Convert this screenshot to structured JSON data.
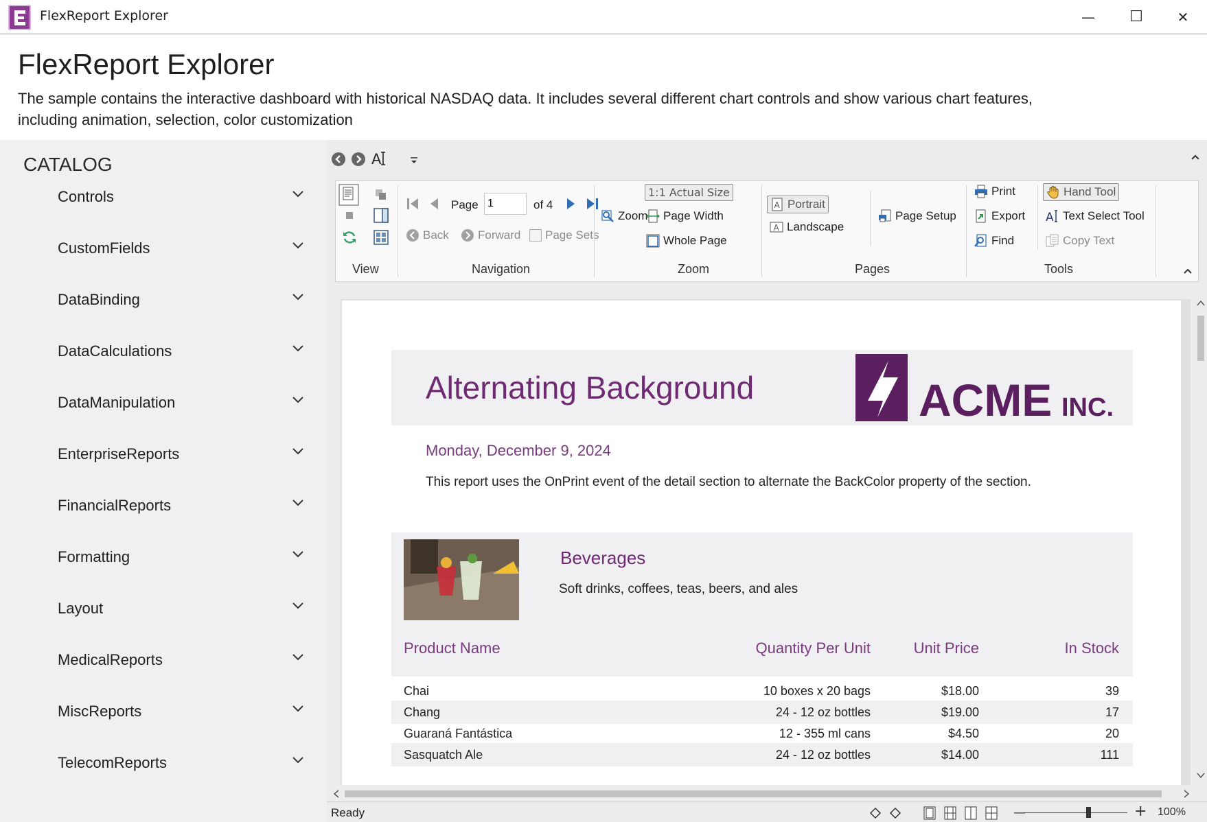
{
  "window": {
    "title": "FlexReport Explorer",
    "minimize": "—",
    "maximize": "☐",
    "close": "✕"
  },
  "header": {
    "title": "FlexReport Explorer",
    "description": "The sample contains the interactive dashboard with historical NASDAQ data. It includes several different chart controls and show various chart features, including animation, selection, color customization"
  },
  "sidebar": {
    "heading": "CATALOG",
    "items": [
      {
        "label": "Controls"
      },
      {
        "label": "CustomFields"
      },
      {
        "label": "DataBinding"
      },
      {
        "label": "DataCalculations"
      },
      {
        "label": "DataManipulation"
      },
      {
        "label": "EnterpriseReports"
      },
      {
        "label": "FinancialReports"
      },
      {
        "label": "Formatting"
      },
      {
        "label": "Layout"
      },
      {
        "label": "MedicalReports"
      },
      {
        "label": "MiscReports"
      },
      {
        "label": "TelecomReports"
      }
    ]
  },
  "ribbon": {
    "groups": {
      "view": "View",
      "navigation": "Navigation",
      "zoom": "Zoom",
      "pages": "Pages",
      "tools": "Tools"
    },
    "navigation": {
      "page_label": "Page",
      "page_value": "1",
      "of_label": "of 4",
      "back": "Back",
      "forward": "Forward",
      "page_sets": "Page Sets"
    },
    "zoom": {
      "zoom": "Zoom",
      "actual_size": "1:1 Actual Size",
      "page_width": "Page Width",
      "whole_page": "Whole Page"
    },
    "pages": {
      "portrait": "Portrait",
      "landscape": "Landscape",
      "page_setup": "Page Setup"
    },
    "tools": {
      "print": "Print",
      "export": "Export",
      "find": "Find",
      "hand_tool": "Hand Tool",
      "text_select": "Text Select Tool",
      "copy_text": "Copy Text"
    }
  },
  "report": {
    "title": "Alternating Background",
    "logo_text": "ACME",
    "logo_suffix": "INC.",
    "date": "Monday, December 9, 2024",
    "note": "This report uses the OnPrint event of the detail section to alternate the BackColor property of the section.",
    "category": {
      "name": "Beverages",
      "description": "Soft drinks, coffees, teas, beers, and ales"
    },
    "columns": [
      "Product Name",
      "Quantity Per Unit",
      "Unit Price",
      "In Stock"
    ],
    "rows": [
      [
        "Chai",
        "10 boxes x 20 bags",
        "$18.00",
        "39"
      ],
      [
        "Chang",
        "24 - 12 oz bottles",
        "$19.00",
        "17"
      ],
      [
        "Guaraná Fantástica",
        "12 - 355 ml cans",
        "$4.50",
        "20"
      ],
      [
        "Sasquatch Ale",
        "24 - 12 oz bottles",
        "$14.00",
        "111"
      ]
    ]
  },
  "status": {
    "text": "Ready",
    "zoom": "100%"
  },
  "colors": {
    "accent": "#6e2a72",
    "logo": "#5b1f5f",
    "band": "#f0eff1",
    "sidebar": "#f0f0f0"
  }
}
